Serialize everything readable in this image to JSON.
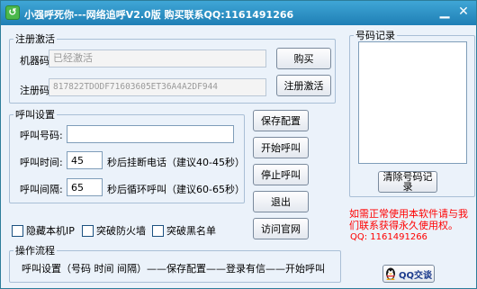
{
  "window": {
    "title": "小强呼死你---网络追呼V2.0版 购买联系QQ:1161491266",
    "app_icon_glyph": "↺",
    "minimize_glyph": "▁",
    "close_glyph": "✕"
  },
  "registration": {
    "group_label": "注册激活",
    "machine_code_label": "机器码",
    "machine_code_value": "已经激活",
    "register_code_label": "注册码",
    "register_code_value": "817822TDODF71603605ET36A4A2DF944",
    "buy_button": "购买",
    "activate_button": "注册激活"
  },
  "call_settings": {
    "group_label": "呼叫设置",
    "number_label": "呼叫号码:",
    "number_value": "",
    "time_label": "呼叫时间:",
    "time_value": "45",
    "time_suffix": "秒后挂断电话（建议40-45秒）",
    "interval_label": "呼叫间隔:",
    "interval_value": "65",
    "interval_suffix": "秒后循环呼叫（建议60-65秒）"
  },
  "actions": {
    "save_config": "保存配置",
    "start_call": "开始呼叫",
    "stop_call": "停止呼叫",
    "exit": "退出",
    "visit_site": "访问官网"
  },
  "options": {
    "hide_ip": "隐藏本机IP",
    "bypass_firewall": "突破防火墙",
    "bypass_blacklist": "突破黑名单"
  },
  "process": {
    "group_label": "操作流程",
    "text": "呼叫设置（号码 时间 间隔）——保存配置——登录有信——开始呼叫"
  },
  "records": {
    "group_label": "号码记录",
    "clear_button": "清除号码记录"
  },
  "notice": {
    "text": "如需正常使用本软件请与我们联系获得永久使用权。",
    "qq": "QQ: 1161491266"
  },
  "qq_chat": {
    "label": "QQ交谈",
    "icon": "qq-penguin-icon"
  },
  "colors": {
    "title_bar": "#2a8fc4",
    "window_bg": "#ebf2fa",
    "notice_red": "#ff0000"
  }
}
